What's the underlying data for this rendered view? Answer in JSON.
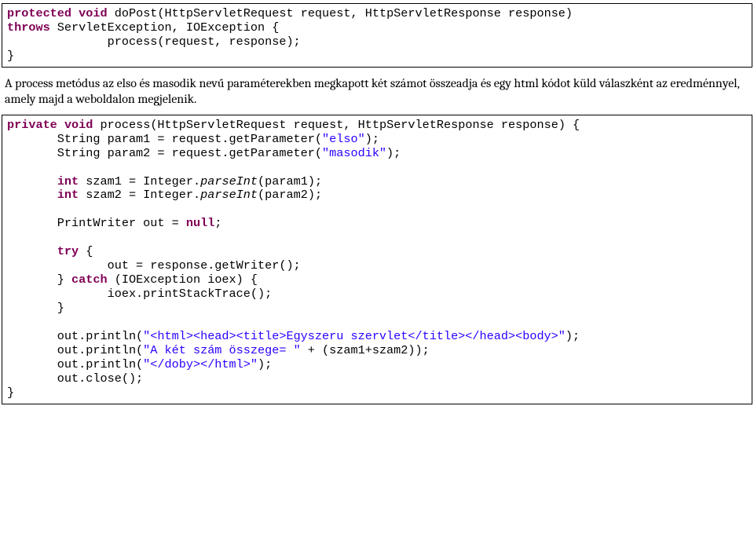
{
  "block1": {
    "t1a": "protected",
    "t1b": "void",
    "t1c": " doPost(HttpServletRequest request, HttpServletResponse response)",
    "t2a": "throws",
    "t2b": " ServletException, IOException {",
    "t3": "              process(request, response);",
    "t4": "}"
  },
  "para1": "A process metódus az elso és masodik nevű paraméterekben megkapott két számot összeadja és egy html kódot küld válaszként az eredménnyel, amely majd a weboldalon megjelenik.",
  "block2": {
    "l1a": "private",
    "l1b": "void",
    "l1c": " process(HttpServletRequest request, HttpServletResponse response) {",
    "l2a": "       String param1 = request.getParameter(",
    "l2b": "\"elso\"",
    "l2c": ");",
    "l3a": "       String param2 = request.getParameter(",
    "l3b": "\"masodik\"",
    "l3c": ");",
    "l4": "",
    "l5a": "       ",
    "l5b": "int",
    "l5c": " szam1 = Integer.",
    "l5d": "parseInt",
    "l5e": "(param1);",
    "l6a": "       ",
    "l6b": "int",
    "l6c": " szam2 = Integer.",
    "l6d": "parseInt",
    "l6e": "(param2);",
    "l7": "",
    "l8a": "       PrintWriter out = ",
    "l8b": "null",
    "l8c": ";",
    "l9": "",
    "l10a": "       ",
    "l10b": "try",
    "l10c": " {",
    "l11": "              out = response.getWriter();",
    "l12a": "       } ",
    "l12b": "catch",
    "l12c": " (IOException ioex) {",
    "l13": "              ioex.printStackTrace();",
    "l14": "       }",
    "l15": "",
    "l16a": "       out.println(",
    "l16b": "\"<html><head><title>Egyszeru szervlet</title></head><body>\"",
    "l16c": ");",
    "l17a": "       out.println(",
    "l17b": "\"A két szám összege= \"",
    "l17c": " + (szam1+szam2));",
    "l18a": "       out.println(",
    "l18b": "\"</doby></html>\"",
    "l18c": ");",
    "l19": "       out.close();",
    "l20": "}"
  }
}
